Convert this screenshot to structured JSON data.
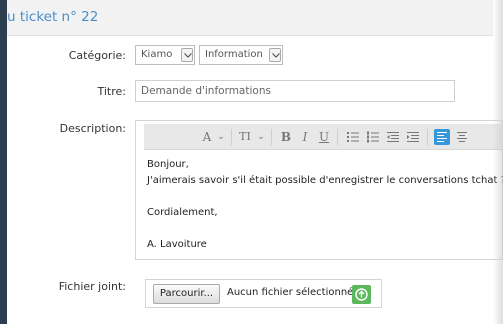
{
  "header": {
    "title": "u ticket n° 22"
  },
  "form": {
    "category": {
      "label": "Catégorie:",
      "select1": "Kiamo",
      "select2": "Information"
    },
    "title": {
      "label": "Titre:",
      "value": "Demande d'informations"
    },
    "description": {
      "label": "Description:",
      "toolbar": {
        "font": "A",
        "font_size": "TI",
        "bold": "B",
        "italic": "I",
        "underline": "U"
      },
      "lines": [
        "Bonjour,",
        "J'aimerais savoir s'il était possible d'enregistrer le conversations tchat ?",
        "",
        "Cordialement,",
        "",
        "A. Lavoiture"
      ]
    },
    "attachment": {
      "label": "Fichier joint:",
      "browse": "Parcourir...",
      "status": "Aucun fichier sélectionné."
    }
  },
  "colors": {
    "accent": "#4a8ec9",
    "sidebar": "#2d3e50",
    "upload": "#5cb85c",
    "active_tool": "#3498db"
  }
}
